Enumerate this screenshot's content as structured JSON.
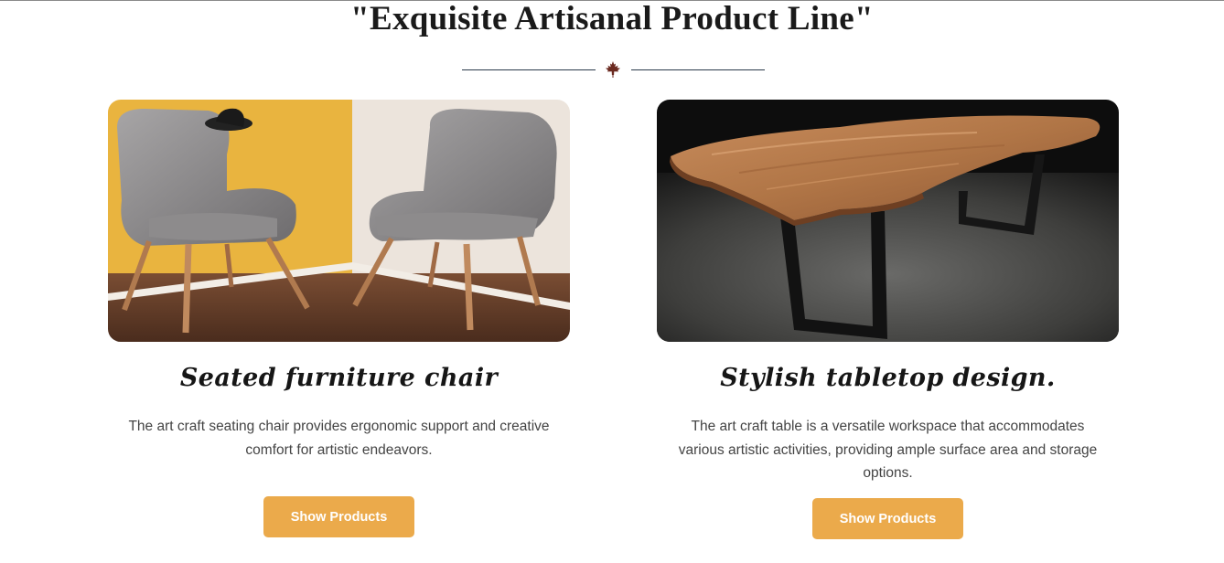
{
  "section": {
    "title": "\"Exquisite Artisanal Product Line\"",
    "divider_icon": "maple-leaf-icon",
    "divider_color": "#2a3a4a",
    "leaf_color": "#6b2a20"
  },
  "cards": [
    {
      "image": "two grey velvet armchairs with wooden legs against a yellow and white wall",
      "title": "Seated furniture chair",
      "description": "The art craft seating chair provides ergonomic support and creative comfort for artistic endeavors.",
      "button_label": "Show Products"
    },
    {
      "image": "live-edge wooden table with black metal legs on concrete floor",
      "title": "Stylish tabletop design.",
      "description": "The art craft table is a versatile workspace that accommodates various artistic activities, providing ample surface area and storage options.",
      "button_label": "Show Products"
    }
  ],
  "colors": {
    "button": "#ebaa4b",
    "button_text": "#ffffff",
    "title_text": "#161616",
    "body_text": "#444444"
  }
}
